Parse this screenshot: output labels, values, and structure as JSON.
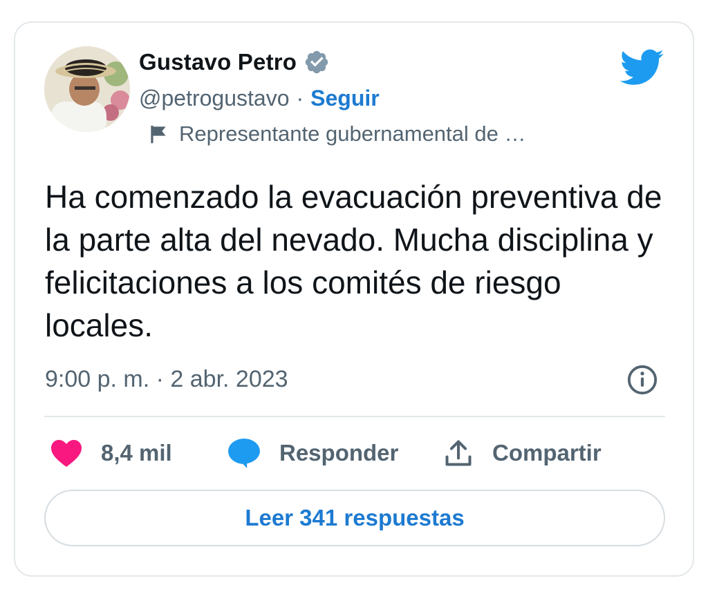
{
  "author": {
    "name": "Gustavo Petro",
    "handle": "@petrogustavo",
    "separator": "·",
    "follow_label": "Seguir",
    "account_label": "Representante gubernamental de …"
  },
  "tweet": {
    "text": "Ha comenzado la evacuación preventiva de la parte alta del nevado. Mucha disciplina y felicitaciones a los comités de riesgo locales.",
    "timestamp": "9:00 p. m. · 2 abr. 2023"
  },
  "actions": {
    "like_count": "8,4 mil",
    "reply_label": "Responder",
    "share_label": "Compartir",
    "read_replies_label": "Leer 341 respuestas"
  },
  "icons": {
    "verified": "verified-badge-icon",
    "bird": "twitter-bird-icon",
    "flag": "flag-icon",
    "info": "info-icon",
    "like": "heart-icon",
    "reply": "speech-bubble-icon",
    "share": "share-upload-icon"
  },
  "colors": {
    "accent_blue": "#1d7ad1",
    "twitter_blue": "#1d9bf0",
    "like_pink": "#f91880",
    "secondary_text": "#536471",
    "verified_gray": "#829aab"
  }
}
